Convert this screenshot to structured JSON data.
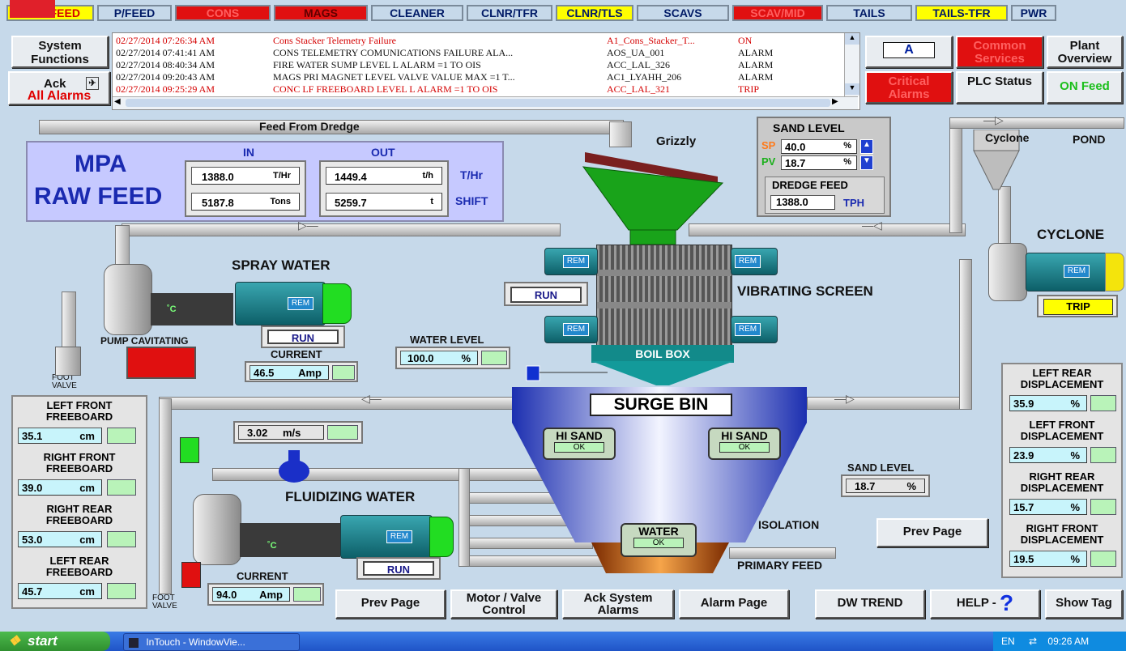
{
  "tabs": [
    {
      "label": "RAW FEED",
      "bg": "#ffff00",
      "fg": "#d40000"
    },
    {
      "label": "P/FEED",
      "bg": "#c6d9ea",
      "fg": "#001a66"
    },
    {
      "label": "CONS",
      "bg": "#e01010",
      "fg": "#ff6060"
    },
    {
      "label": "MAGS",
      "bg": "#e01010",
      "fg": "#600000"
    },
    {
      "label": "CLEANER",
      "bg": "#c6d9ea",
      "fg": "#001a66"
    },
    {
      "label": "CLNR/TFR",
      "bg": "#c6d9ea",
      "fg": "#001a66"
    },
    {
      "label": "CLNR/TLS",
      "bg": "#ffff00",
      "fg": "#001a66"
    },
    {
      "label": "SCAVS",
      "bg": "#c6d9ea",
      "fg": "#001a66"
    },
    {
      "label": "SCAV/MID",
      "bg": "#e01010",
      "fg": "#ff6060"
    },
    {
      "label": "TAILS",
      "bg": "#c6d9ea",
      "fg": "#001a66"
    },
    {
      "label": "TAILS-TFR",
      "bg": "#ffff00",
      "fg": "#001a66"
    },
    {
      "label": "PWR",
      "bg": "#c6d9ea",
      "fg": "#001a66"
    }
  ],
  "left_buttons": {
    "system_functions": "System\nFunctions",
    "ack": "Ack",
    "all_alarms": "All Alarms"
  },
  "alarms": [
    {
      "time": "02/27/2014 07:26:34 AM",
      "desc": "Cons Stacker Telemetry Failure",
      "tag": "A1_Cons_Stacker_T...",
      "state": "ON",
      "color": "#d40000"
    },
    {
      "time": "02/27/2014 07:41:41 AM",
      "desc": "CONS TELEMETRY COMUNICATIONS FAILURE  ALA...",
      "tag": "AOS_UA_001",
      "state": "ALARM",
      "color": "#111111"
    },
    {
      "time": "02/27/2014 08:40:34 AM",
      "desc": "FIRE WATER SUMP LEVEL L ALARM =1 TO OIS",
      "tag": "ACC_LAL_326",
      "state": "ALARM",
      "color": "#111111"
    },
    {
      "time": "02/27/2014 09:20:43 AM",
      "desc": "MAGS PRI MAGNET LEVEL VALVE VALUE MAX =1 T...",
      "tag": "AC1_LYAHH_206",
      "state": "ALARM",
      "color": "#111111"
    },
    {
      "time": "02/27/2014 09:25:29 AM",
      "desc": "CONC LF FREEBOARD LEVEL L ALARM =1 TO OIS",
      "tag": "ACC_LAL_321",
      "state": "TRIP",
      "color": "#d40000"
    }
  ],
  "right_buttons": {
    "a_btn": "A",
    "common_services": "Common Services",
    "plant_overview": "Plant Overview",
    "critical_alarms": "Critical Alarms",
    "plc_status": "PLC Status",
    "on_feed": "ON Feed"
  },
  "mpa": {
    "title1": "MPA",
    "title2": "RAW FEED",
    "in": "IN",
    "out": "OUT",
    "in_rate": "1388.0",
    "in_rate_unit": "T/Hr",
    "in_shift": "5187.8",
    "in_shift_unit": "Tons",
    "out_rate": "1449.4",
    "out_rate_unit": "t/h",
    "out_shift": "5259.7",
    "out_shift_unit": "t",
    "rate_label": "T/Hr",
    "shift_label": "SHIFT"
  },
  "feed_from_dredge": "Feed From Dredge",
  "grizzly": "Grizzly",
  "sand_level_panel": {
    "title": "SAND LEVEL",
    "sp_label": "SP",
    "sp": "40.0",
    "sp_unit": "%",
    "pv_label": "PV",
    "pv": "18.7",
    "pv_unit": "%",
    "dredge_title": "DREDGE FEED",
    "dredge": "1388.0",
    "dredge_unit": "TPH"
  },
  "cyclone_labels": {
    "cyclone_small": "Cyclone",
    "pond": "POND",
    "cyclone": "CYCLONE",
    "trip": "TRIP"
  },
  "spray_water": {
    "title": "SPRAY WATER",
    "run": "RUN",
    "current": "CURRENT",
    "amps": "46.5",
    "amps_unit": "Amp",
    "pump_cav": "PUMP CAVITATING",
    "foot_valve": "FOOT\nVALVE"
  },
  "vibrating_screen": {
    "title": "VIBRATING SCREEN",
    "run": "RUN",
    "rem": "REM",
    "boil_box": "BOIL BOX"
  },
  "water_level": {
    "title": "WATER LEVEL",
    "value": "100.0",
    "unit": "%"
  },
  "surge_bin": {
    "title": "SURGE BIN",
    "hi_sand": "HI SAND",
    "ok": "OK",
    "water": "WATER"
  },
  "left_freeboard": [
    {
      "title": "LEFT FRONT\nFREEBOARD",
      "value": "35.1",
      "unit": "cm"
    },
    {
      "title": "RIGHT FRONT\nFREEBOARD",
      "value": "39.0",
      "unit": "cm"
    },
    {
      "title": "RIGHT REAR\nFREEBOARD",
      "value": "53.0",
      "unit": "cm"
    },
    {
      "title": "LEFT REAR\nFREEBOARD",
      "value": "45.7",
      "unit": "cm"
    }
  ],
  "flow_speed": {
    "value": "3.02",
    "unit": "m/s"
  },
  "fluidizing": {
    "title": "FLUIDIZING WATER",
    "run": "RUN",
    "current": "CURRENT",
    "amps": "94.0",
    "amps_unit": "Amp",
    "foot_valve": "FOOT\nVALVE"
  },
  "sand_level_small": {
    "title": "SAND LEVEL",
    "value": "18.7",
    "unit": "%"
  },
  "isolation": "ISOLATION",
  "primary_feed": "PRIMARY FEED",
  "displacement": [
    {
      "title": "LEFT REAR\nDISPLACEMENT",
      "value": "35.9",
      "unit": "%"
    },
    {
      "title": "LEFT FRONT\nDISPLACEMENT",
      "value": "23.9",
      "unit": "%"
    },
    {
      "title": "RIGHT REAR\nDISPLACEMENT",
      "value": "15.7",
      "unit": "%"
    },
    {
      "title": "RIGHT FRONT\nDISPLACEMENT",
      "value": "19.5",
      "unit": "%"
    }
  ],
  "bottom_buttons": {
    "prev_page": "Prev Page",
    "motor_valve": "Motor / Valve\nControl",
    "ack_system": "Ack System\nAlarms",
    "alarm_page": "Alarm Page",
    "dw_trend": "DW TREND",
    "help": "HELP -",
    "show_tag": "Show Tag",
    "prev_page_right": "Prev Page"
  },
  "taskbar": {
    "start": "start",
    "task": "InTouch - WindowVie...",
    "lang": "EN",
    "time": "09:26 AM"
  },
  "icons": [
    "gear-icon",
    "speaker-icon",
    "question-icon",
    "windows-logo-icon",
    "intouch-app-icon",
    "network-icon"
  ]
}
